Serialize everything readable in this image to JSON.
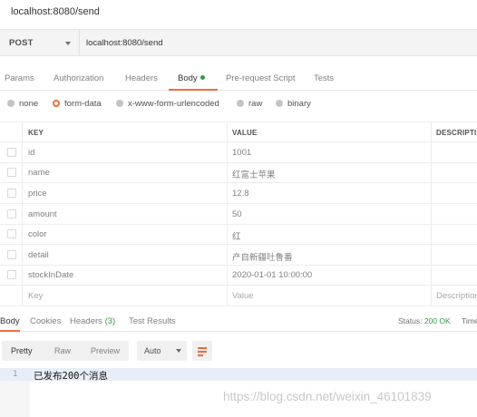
{
  "window": {
    "title": "localhost:8080/send"
  },
  "request": {
    "method": "POST",
    "url": "localhost:8080/send"
  },
  "request_tabs": [
    {
      "label": "Params"
    },
    {
      "label": "Authorization"
    },
    {
      "label": "Headers"
    },
    {
      "label": "Body",
      "active": true,
      "indicator": "green-dot-icon"
    },
    {
      "label": "Pre-request Script"
    },
    {
      "label": "Tests"
    }
  ],
  "body_types": [
    {
      "label": "none",
      "selected": false
    },
    {
      "label": "form-data",
      "selected": true
    },
    {
      "label": "x-www-form-urlencoded",
      "selected": false
    },
    {
      "label": "raw",
      "selected": false
    },
    {
      "label": "binary",
      "selected": false
    }
  ],
  "table": {
    "headers": {
      "key": "KEY",
      "value": "VALUE",
      "description": "DESCRIPTION"
    },
    "rows": [
      {
        "key": "id",
        "value": "1001"
      },
      {
        "key": "name",
        "value": "红富士苹果"
      },
      {
        "key": "price",
        "value": "12.8"
      },
      {
        "key": "amount",
        "value": "50"
      },
      {
        "key": "color",
        "value": "红"
      },
      {
        "key": "detail",
        "value": "产自新疆吐鲁番"
      },
      {
        "key": "stockInDate",
        "value": "2020-01-01 10:00:00"
      }
    ],
    "placeholder": {
      "key": "Key",
      "value": "Value",
      "description": "Description"
    }
  },
  "response_tabs": [
    {
      "label": "Body",
      "active": true
    },
    {
      "label": "Cookies"
    },
    {
      "label": "Headers",
      "count": "(3)"
    },
    {
      "label": "Test Results"
    }
  ],
  "status": {
    "label": "Status:",
    "value": "200 OK",
    "time_label": "Time"
  },
  "format_bar": {
    "modes": [
      "Pretty",
      "Raw",
      "Preview"
    ],
    "active_mode": "Pretty",
    "language": "Auto",
    "wrap_icon": "wrap-lines-icon"
  },
  "response_body": {
    "line_number": "1",
    "text": "已发布200个消息"
  },
  "watermark": "https://blog.csdn.net/weixin_46101839",
  "colors": {
    "accent": "#f26b3a",
    "success": "#2f9e44",
    "line_highlight": "#e8eef8"
  }
}
